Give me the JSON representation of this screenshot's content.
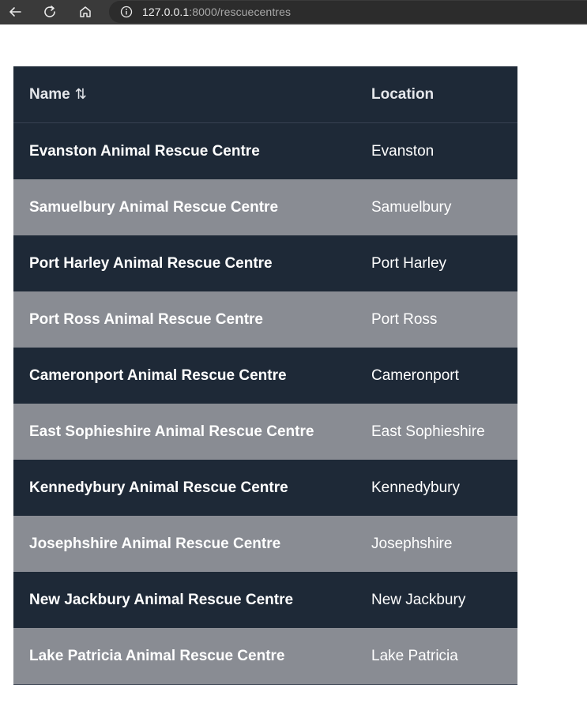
{
  "browser": {
    "url_host": "127.0.0.1",
    "url_path": ":8000/rescuecentres",
    "icons": {
      "back": "back-arrow-icon",
      "reload": "reload-icon",
      "home": "home-icon",
      "info": "info-icon"
    }
  },
  "table": {
    "headers": {
      "name": "Name",
      "name_sort_glyph": "⇅",
      "location": "Location"
    },
    "rows": [
      {
        "name": "Evanston Animal Rescue Centre",
        "location": "Evanston"
      },
      {
        "name": "Samuelbury Animal Rescue Centre",
        "location": "Samuelbury"
      },
      {
        "name": "Port Harley Animal Rescue Centre",
        "location": "Port Harley"
      },
      {
        "name": "Port Ross Animal Rescue Centre",
        "location": "Port Ross"
      },
      {
        "name": "Cameronport Animal Rescue Centre",
        "location": "Cameronport"
      },
      {
        "name": "East Sophieshire Animal Rescue Centre",
        "location": "East Sophieshire"
      },
      {
        "name": "Kennedybury Animal Rescue Centre",
        "location": "Kennedybury"
      },
      {
        "name": "Josephshire Animal Rescue Centre",
        "location": "Josephshire"
      },
      {
        "name": "New Jackbury Animal Rescue Centre",
        "location": "New Jackbury"
      },
      {
        "name": "Lake Patricia Animal Rescue Centre",
        "location": "Lake Patricia"
      }
    ]
  },
  "colors": {
    "row_dark": "#1e2937",
    "row_light": "#898c93",
    "browser_bar": "#3a3a3a",
    "text": "#ffffff"
  }
}
